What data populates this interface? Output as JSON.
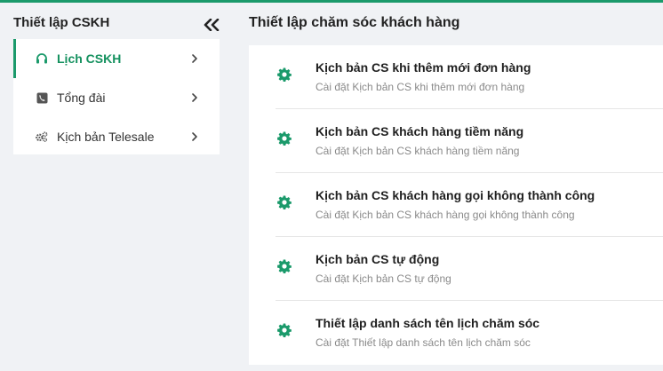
{
  "colors": {
    "accent": "#1b9a6b",
    "background": "#f0f2f5"
  },
  "sidebar": {
    "title": "Thiết lập CSKH",
    "collapse_icon": "double-chevron-left-icon",
    "items": [
      {
        "label": "Lịch CSKH",
        "icon": "headset-icon",
        "active": true
      },
      {
        "label": "Tổng đài",
        "icon": "phone-icon",
        "active": false
      },
      {
        "label": "Kịch bản Telesale",
        "icon": "gears-icon",
        "active": false
      }
    ]
  },
  "main": {
    "title": "Thiết lập chăm sóc khách hàng",
    "settings": [
      {
        "title": "Kịch bản CS khi thêm mới đơn hàng",
        "description": "Cài đặt Kịch bản CS khi thêm mới đơn hàng"
      },
      {
        "title": "Kịch bản CS khách hàng tiềm năng",
        "description": "Cài đặt Kịch bản CS khách hàng tiềm năng"
      },
      {
        "title": "Kịch bản CS khách hàng gọi không thành công",
        "description": "Cài đặt Kịch bản CS khách hàng gọi không thành công"
      },
      {
        "title": "Kịch bản CS tự động",
        "description": "Cài đặt Kịch bản CS tự động"
      },
      {
        "title": "Thiết lập danh sách tên lịch chăm sóc",
        "description": "Cài đặt Thiết lập danh sách tên lịch chăm sóc"
      }
    ]
  }
}
